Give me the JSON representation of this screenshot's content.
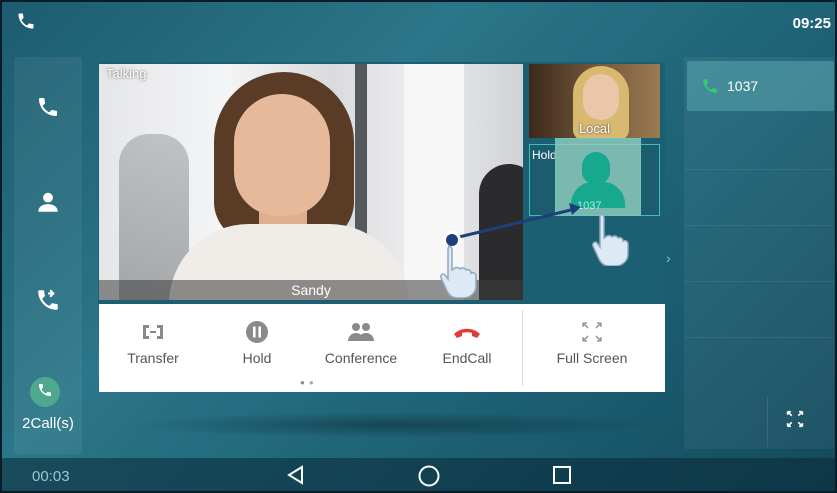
{
  "status_bar": {
    "time": "09:25",
    "call_icon": "phone-icon"
  },
  "left_panel": {
    "items": [
      {
        "name": "phone-icon"
      },
      {
        "name": "contacts-icon"
      },
      {
        "name": "call-history-icon"
      }
    ],
    "call_count_label": "2Call(s)"
  },
  "video": {
    "status_label": "Talking",
    "remote_name": "Sandy",
    "local_label": "Local",
    "hold_label": "Hold",
    "hold_number": "1037"
  },
  "actions": [
    {
      "label": "Transfer",
      "icon": "transfer-icon"
    },
    {
      "label": "Hold",
      "icon": "hold-icon"
    },
    {
      "label": "Conference",
      "icon": "conference-icon"
    },
    {
      "label": "EndCall",
      "icon": "end-call-icon"
    },
    {
      "label": "Full Screen",
      "icon": "full-screen-icon"
    }
  ],
  "right_panel": {
    "active_call": "1037"
  },
  "nav": {
    "duration": "00:03",
    "buttons": [
      "back-icon",
      "home-icon",
      "recents-icon"
    ]
  },
  "colors": {
    "background": "#2b7688",
    "end_call": "#e23b3b",
    "accent_green": "#17a890",
    "hold_border": "#3cc0b8"
  }
}
